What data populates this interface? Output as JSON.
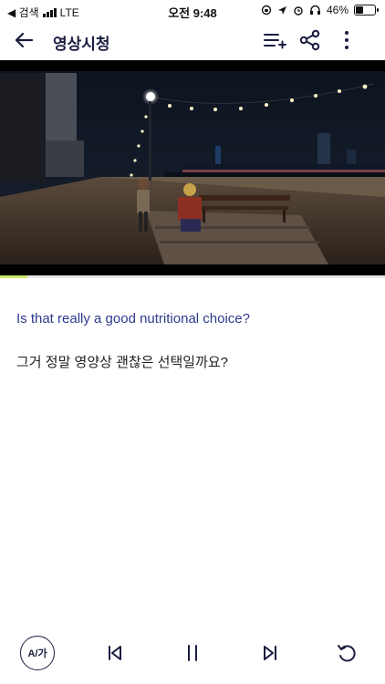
{
  "status_bar": {
    "back_app": "◀ 검색",
    "network": "LTE",
    "time": "오전 9:48",
    "battery": "46%",
    "battery_level": 0.46
  },
  "header": {
    "title": "영상시청",
    "icons": [
      "back-arrow-icon",
      "playlist-add-icon",
      "share-icon",
      "more-vert-icon"
    ]
  },
  "video": {
    "progress": 0.07
  },
  "subtitles": {
    "english": "Is that really a good nutritional choice?",
    "korean": "그거 정말 영양상 괜찮은 선택일까요?"
  },
  "controls": {
    "language_toggle": "A/가",
    "icons": [
      "previous-icon",
      "pause-icon",
      "next-icon",
      "replay-icon"
    ]
  },
  "colors": {
    "accent_dark": "#1a1d40",
    "english_subtitle": "#2e3a8c",
    "progress": "#c7e86b"
  }
}
